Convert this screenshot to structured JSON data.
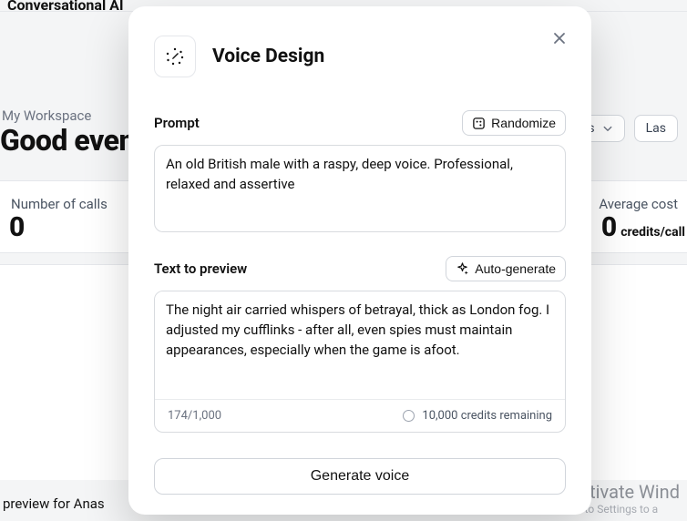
{
  "background": {
    "top_cut_title": "Conversational AI",
    "workspace_label": "My Workspace",
    "greeting": "Good evenin",
    "filter_agents": "gents",
    "filter_last": "Las",
    "number_of_calls_label": "Number of calls",
    "number_of_calls_value": "0",
    "average_cost_label": "Average cost",
    "average_cost_value": "0",
    "average_cost_unit": "credits/call",
    "bottom_text": "preview for Anas",
    "watermark_title": "Activate Wind",
    "watermark_sub": "Go to Settings to a"
  },
  "modal": {
    "title": "Voice Design",
    "prompt": {
      "label": "Prompt",
      "randomize": "Randomize",
      "value": "An old British male with a raspy, deep voice. Professional, relaxed and assertive"
    },
    "preview": {
      "label": "Text to preview",
      "autogen": "Auto-generate",
      "value": "The night air carried whispers of betrayal, thick as London fog. I adjusted my cufflinks - after all, even spies must maintain appearances, especially when the game is afoot.",
      "char_count": "174/1,000",
      "credits": "10,000 credits remaining"
    },
    "generate": "Generate voice"
  }
}
